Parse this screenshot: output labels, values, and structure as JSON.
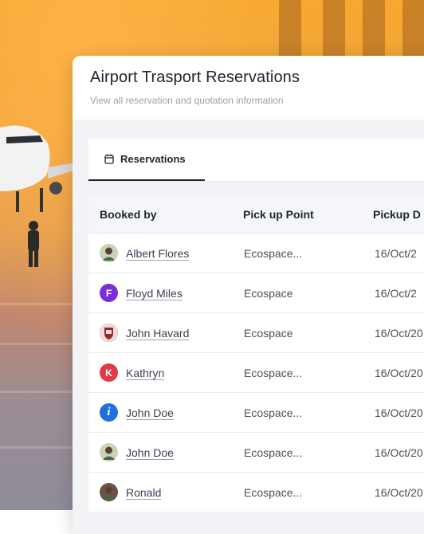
{
  "card": {
    "title": "Airport Trasport Reservations",
    "subtitle": "View all reservation and quotation information"
  },
  "tabs": [
    {
      "label": "Reservations",
      "icon": "calendar-icon",
      "active": true
    }
  ],
  "table": {
    "headers": [
      "Booked by",
      "Pick up Point",
      "Pickup D"
    ],
    "rows": [
      {
        "name": "Albert Flores",
        "avatar": {
          "type": "image",
          "icon": "avatar-photo-icon",
          "color": "#c9d3b6"
        },
        "pickup": "Ecospace...",
        "date": "16/Oct/2"
      },
      {
        "name": "Floyd Miles",
        "avatar": {
          "type": "initial",
          "letter": "F",
          "color": "#7a2fd6"
        },
        "pickup": "Ecospace",
        "date": "16/Oct/2"
      },
      {
        "name": "John Havard",
        "avatar": {
          "type": "image",
          "icon": "crest-icon",
          "color": "#a3212b"
        },
        "pickup": "Ecospace",
        "date": "16/Oct/20"
      },
      {
        "name": "Kathryn",
        "avatar": {
          "type": "initial",
          "letter": "K",
          "color": "#e23a43"
        },
        "pickup": "Ecospace...",
        "date": "16/Oct/20"
      },
      {
        "name": "John Doe",
        "avatar": {
          "type": "initial",
          "letter": "i",
          "color": "#1f6fe0"
        },
        "pickup": "Ecospace...",
        "date": "16/Oct/20"
      },
      {
        "name": "John Doe",
        "avatar": {
          "type": "image",
          "icon": "avatar-photo-icon",
          "color": "#c9d3b6"
        },
        "pickup": "Ecospace...",
        "date": "16/Oct/20"
      },
      {
        "name": "Ronald",
        "avatar": {
          "type": "image",
          "icon": "avatar-photo-icon",
          "color": "#6b5447"
        },
        "pickup": "Ecospace...",
        "date": "16/Oct/20"
      }
    ]
  }
}
